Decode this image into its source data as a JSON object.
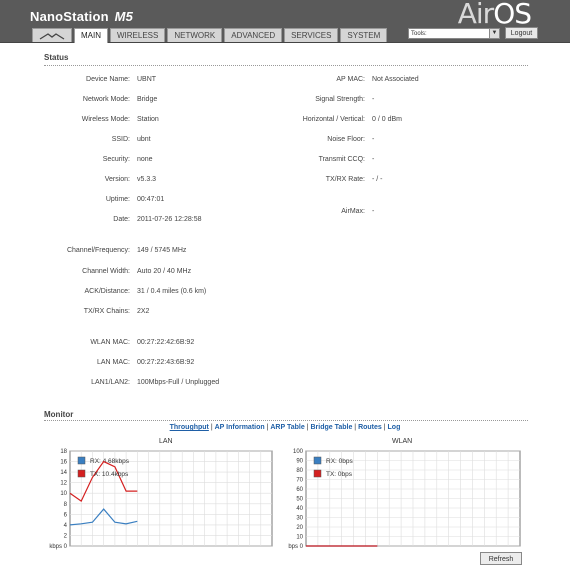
{
  "brand": {
    "name": "NanoStation",
    "model": "M5",
    "product_logo_air": "Air",
    "product_logo_os": "OS",
    "tm": "™"
  },
  "tabs": [
    {
      "label": "",
      "icon": "ubiquiti-logo-icon"
    },
    {
      "label": "MAIN"
    },
    {
      "label": "WIRELESS"
    },
    {
      "label": "NETWORK"
    },
    {
      "label": "ADVANCED"
    },
    {
      "label": "SERVICES"
    },
    {
      "label": "SYSTEM"
    }
  ],
  "toolbar": {
    "tools_value": "Tools:",
    "logout_label": "Logout"
  },
  "status": {
    "title": "Status",
    "left": [
      {
        "label": "Device Name:",
        "value": "UBNT"
      },
      {
        "label": "Network Mode:",
        "value": "Bridge"
      },
      {
        "label": "Wireless Mode:",
        "value": "Station"
      },
      {
        "label": "SSID:",
        "value": "ubnt"
      },
      {
        "label": "Security:",
        "value": "none"
      },
      {
        "label": "Version:",
        "value": "v5.3.3"
      },
      {
        "label": "Uptime:",
        "value": "00:47:01"
      },
      {
        "label": "Date:",
        "value": "2011-07-26 12:28:58"
      },
      {
        "label": "Channel/Frequency:",
        "value": "149 / 5745 MHz"
      },
      {
        "label": "Channel Width:",
        "value": "Auto 20 / 40 MHz"
      },
      {
        "label": "ACK/Distance:",
        "value": "31 / 0.4 miles (0.6 km)"
      },
      {
        "label": "TX/RX Chains:",
        "value": "2X2"
      },
      {
        "label": "WLAN MAC:",
        "value": "00:27:22:42:6B:92"
      },
      {
        "label": "LAN MAC:",
        "value": "00:27:22:43:6B:92"
      },
      {
        "label": "LAN1/LAN2:",
        "value": "100Mbps-Full / Unplugged"
      }
    ],
    "right": [
      {
        "label": "AP MAC:",
        "value": "Not Associated"
      },
      {
        "label": "Signal Strength:",
        "value": "-"
      },
      {
        "label": "Horizontal / Vertical:",
        "value": "0 / 0 dBm"
      },
      {
        "label": "Noise Floor:",
        "value": "-"
      },
      {
        "label": "Transmit CCQ:",
        "value": "-"
      },
      {
        "label": "TX/RX Rate:",
        "value": "- / -"
      },
      {
        "label": "AirMax:",
        "value": "-"
      }
    ]
  },
  "monitor": {
    "title": "Monitor",
    "links": [
      "Throughput",
      "AP Information",
      "ARP Table",
      "Bridge Table",
      "Routes",
      "Log"
    ],
    "refresh_label": "Refresh"
  },
  "chart_data": [
    {
      "type": "line",
      "title": "LAN",
      "ylabel": "kbps",
      "ylim": [
        0,
        18
      ],
      "yticks": [
        0,
        2,
        4,
        6,
        8,
        10,
        12,
        14,
        16,
        18
      ],
      "grid": true,
      "legend_position": "top-left",
      "x": [
        0,
        1,
        2,
        3,
        4,
        5,
        6,
        7,
        8,
        9,
        10,
        11,
        12,
        13,
        14,
        15,
        16,
        17,
        18,
        19,
        20,
        21,
        22,
        23,
        24,
        25,
        26,
        27,
        28,
        29
      ],
      "series": [
        {
          "name": "RX: 4.68kbps",
          "color": "#3a7fc1",
          "values": [
            4,
            4.2,
            4.5,
            7,
            4.5,
            4.2,
            4.68
          ]
        },
        {
          "name": "TX: 10.4kbps",
          "color": "#d42020",
          "values": [
            10,
            8.5,
            13,
            16,
            15,
            10.4,
            10.4
          ]
        }
      ]
    },
    {
      "type": "line",
      "title": "WLAN",
      "ylabel": "bps",
      "ylim": [
        0,
        100
      ],
      "yticks": [
        0,
        10,
        20,
        30,
        40,
        50,
        60,
        70,
        80,
        90,
        100
      ],
      "grid": true,
      "legend_position": "top-left",
      "series": [
        {
          "name": "RX: 0bps",
          "color": "#3a7fc1",
          "values": [
            0,
            0,
            0,
            0,
            0,
            0,
            0
          ]
        },
        {
          "name": "TX: 0bps",
          "color": "#d42020",
          "values": [
            0,
            0,
            0,
            0,
            0,
            0,
            0
          ]
        }
      ]
    }
  ]
}
